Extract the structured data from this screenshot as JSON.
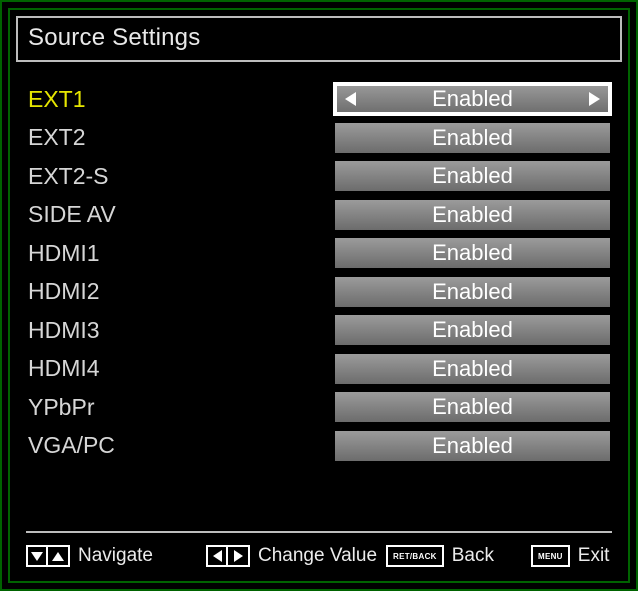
{
  "title": "Source Settings",
  "sources": [
    {
      "label": "EXT1",
      "value": "Enabled",
      "selected": true
    },
    {
      "label": "EXT2",
      "value": "Enabled",
      "selected": false
    },
    {
      "label": "EXT2-S",
      "value": "Enabled",
      "selected": false
    },
    {
      "label": "SIDE AV",
      "value": "Enabled",
      "selected": false
    },
    {
      "label": "HDMI1",
      "value": "Enabled",
      "selected": false
    },
    {
      "label": "HDMI2",
      "value": "Enabled",
      "selected": false
    },
    {
      "label": "HDMI3",
      "value": "Enabled",
      "selected": false
    },
    {
      "label": "HDMI4",
      "value": "Enabled",
      "selected": false
    },
    {
      "label": "YPbPr",
      "value": "Enabled",
      "selected": false
    },
    {
      "label": "VGA/PC",
      "value": "Enabled",
      "selected": false
    }
  ],
  "footer": {
    "navigate": "Navigate",
    "change_value": "Change Value",
    "back_key": "RET/BACK",
    "back": "Back",
    "menu_key": "MENU",
    "exit": "Exit"
  }
}
